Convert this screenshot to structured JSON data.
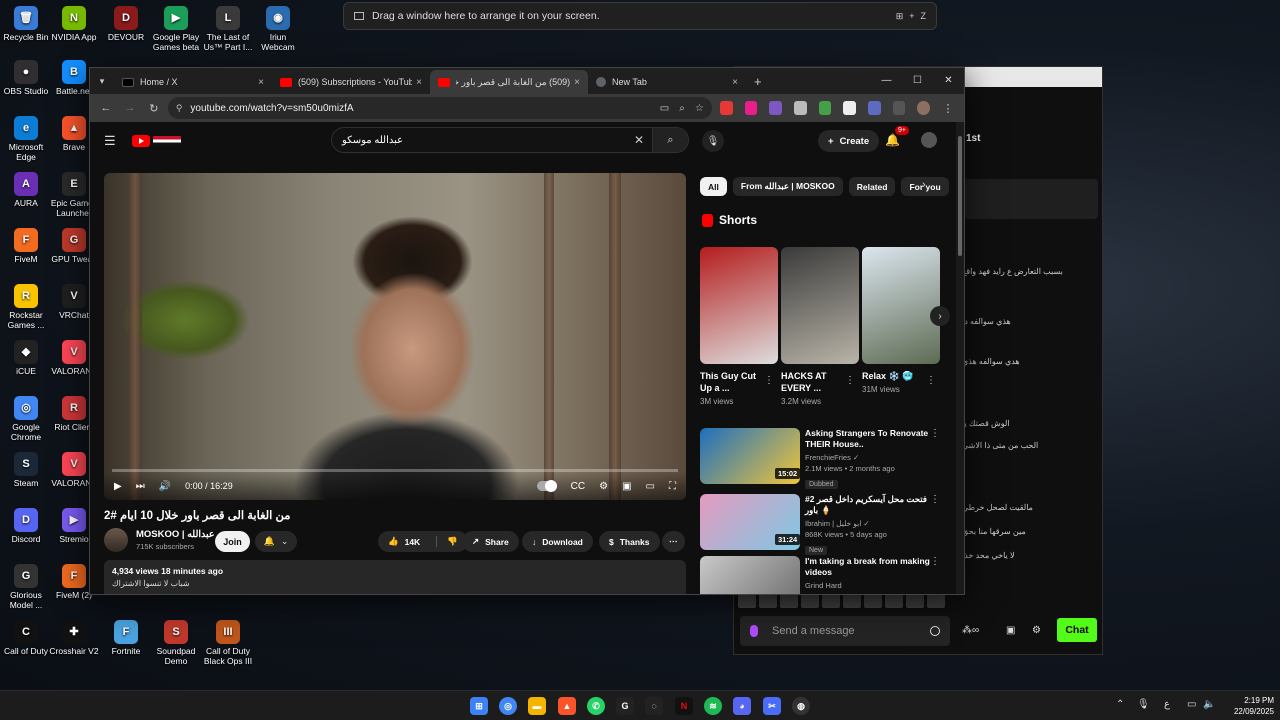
{
  "desktop_icons": [
    {
      "label": "Recycle Bin",
      "color": "#3a7bd5",
      "glyph": "🗑"
    },
    {
      "label": "NVIDIA App",
      "color": "#76b900",
      "glyph": "N"
    },
    {
      "label": "DEVOUR",
      "color": "#8b1a1a",
      "glyph": "D"
    },
    {
      "label": "Google Play Games beta",
      "color": "#1b9e5a",
      "glyph": "▶"
    },
    {
      "label": "The Last of Us™ Part I...",
      "color": "#3a3a3a",
      "glyph": "L"
    },
    {
      "label": "Iriun Webcam",
      "color": "#2b6cb0",
      "glyph": "◉"
    },
    {
      "label": "OBS Studio",
      "color": "#302e31",
      "glyph": "●"
    },
    {
      "label": "Battle.net",
      "color": "#148eff",
      "glyph": "B"
    },
    {
      "label": "Microsoft Edge",
      "color": "#0c7cd5",
      "glyph": "e"
    },
    {
      "label": "Brave",
      "color": "#fb542b",
      "glyph": "▲"
    },
    {
      "label": "AURA",
      "color": "#6b2fb5",
      "glyph": "A"
    },
    {
      "label": "Epic Games Launcher",
      "color": "#2a2a2a",
      "glyph": "E"
    },
    {
      "label": "FiveM",
      "color": "#f26b21",
      "glyph": "F"
    },
    {
      "label": "GPU Tweak",
      "color": "#c0392b",
      "glyph": "G"
    },
    {
      "label": "Rockstar Games ...",
      "color": "#f8c400",
      "glyph": "R"
    },
    {
      "label": "VRChat",
      "color": "#1f1f1f",
      "glyph": "V"
    },
    {
      "label": "iCUE",
      "color": "#222",
      "glyph": "◆"
    },
    {
      "label": "VALORANT",
      "color": "#ff4655",
      "glyph": "V"
    },
    {
      "label": "Google Chrome",
      "color": "#4285f4",
      "glyph": "◎"
    },
    {
      "label": "Riot Client",
      "color": "#d13639",
      "glyph": "R"
    },
    {
      "label": "Steam",
      "color": "#1b2838",
      "glyph": "S"
    },
    {
      "label": "VALORANT",
      "color": "#ff4655",
      "glyph": "V"
    },
    {
      "label": "Discord",
      "color": "#5865f2",
      "glyph": "D"
    },
    {
      "label": "Stremio",
      "color": "#7b5bf5",
      "glyph": "▶"
    },
    {
      "label": "Glorious Model ...",
      "color": "#333",
      "glyph": "G"
    },
    {
      "label": "FiveM (2)",
      "color": "#f26b21",
      "glyph": "F"
    },
    {
      "label": "Call of Duty",
      "color": "#111",
      "glyph": "C"
    },
    {
      "label": "Crosshair V2",
      "color": "#111",
      "glyph": "✚"
    },
    {
      "label": "Fortnite",
      "color": "#4aa3df",
      "glyph": "F"
    },
    {
      "label": "Soundpad Demo",
      "color": "#c0392b",
      "glyph": "S"
    },
    {
      "label": "Call of Duty Black Ops III",
      "color": "#c0561b",
      "glyph": "III"
    }
  ],
  "snap_bar": {
    "text": "Drag a window here to arrange it on your screen.",
    "key_a": "⊞",
    "key_plus": "+",
    "key_b": "Z"
  },
  "browser": {
    "tabs": [
      {
        "label": "Home / X",
        "fav_color": "#000000",
        "active": false
      },
      {
        "label": "(509) Subscriptions - YouTube",
        "fav_color": "#ff0000",
        "active": false
      },
      {
        "label": "(509) من الغابة الى قصر باور خلا",
        "fav_color": "#ff0000",
        "active": true
      },
      {
        "label": "New Tab",
        "fav_color": "#5f6368",
        "active": false
      }
    ],
    "url": "youtube.com/watch?v=sm50u0mizfA",
    "new_tab_glyph": "+",
    "close_glyph": "×"
  },
  "youtube": {
    "search_query": "عبدالله موسكو",
    "create_label": "Create",
    "notif_count": "9+",
    "player": {
      "time": "0:00 / 16:29",
      "progress": 0.0
    },
    "video_title": "من الغابة الى قصر باور خلال 10 ايام #2",
    "channel": {
      "name": "MOSKOO | عبدالله",
      "subs": "715K subscribers"
    },
    "join_label": "Join",
    "actions": {
      "likes": "14K",
      "share": "Share",
      "download": "Download",
      "thanks": "Thanks"
    },
    "description": {
      "stats": "4,934 views  18 minutes ago",
      "text": "شباب لا تنسوا الاشتراك"
    },
    "chips": [
      "All",
      "From عبدالله | MOSKOO",
      "Related",
      "For you"
    ],
    "shorts_title": "Shorts",
    "shorts": [
      {
        "title": "This Guy Cut Up a ...",
        "views": "3M views",
        "color_a": "#b51d1d",
        "color_b": "#ddd"
      },
      {
        "title": "HACKS AT EVERY ...",
        "views": "3.2M views",
        "color_a": "#3a3a3a",
        "color_b": "#b9b4a8"
      },
      {
        "title": "Relax ❄️ 🥶",
        "views": "31M views",
        "color_a": "#dce6ef",
        "color_b": "#5d6b53"
      }
    ],
    "recommendations": [
      {
        "title": "Asking Strangers To Renovate THEIR House..",
        "channel": "FrenchieFries ✓",
        "meta": "2.1M views • 2 months ago",
        "tag": "Dubbed",
        "duration": "15:02",
        "color_a": "#1d6fbf",
        "color_b": "#f0c53a"
      },
      {
        "title": "#2 فتحت محل آيسكريم داخل قصر باور 🍦",
        "channel": "Ibrahim | ابو خليل ✓",
        "meta": "868K views • 5 days ago",
        "tag": "New",
        "duration": "31:24",
        "color_a": "#e49abf",
        "color_b": "#7ec9e3"
      },
      {
        "title": "I'm taking a break from making videos",
        "channel": "Grind Hard",
        "meta": "",
        "tag": "",
        "duration": "",
        "color_a": "#c9c9c9",
        "color_b": "#6a6a6a"
      }
    ]
  },
  "chat": {
    "header": "1st",
    "messages": [
      "هدي سوالفه هذي",
      "بسبب التعارض ع رايد فهد واقع",
      "هذي سوالفه دا",
      "الوش قصتك يا",
      "الحب من متى ذا الاشي",
      "مالقيت لصحل خرطي",
      "مين سرقها منا بحق",
      "لا ياخي محد خذا"
    ],
    "input_placeholder": "Send a message",
    "send_label": "Chat"
  },
  "clock": {
    "time": "2:19 PM",
    "date": "22/09/2025"
  }
}
